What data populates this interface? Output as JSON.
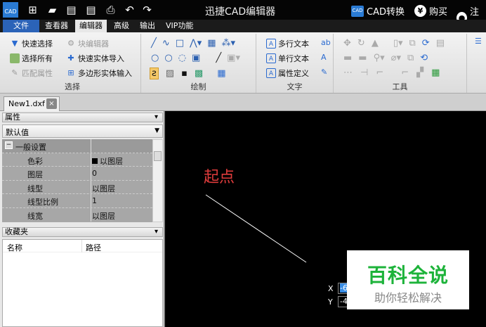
{
  "titlebar": {
    "title": "迅捷CAD编辑器",
    "logo": "CAD",
    "convert": "CAD转换",
    "buy": "购买",
    "register": "注册",
    "icons": [
      "new-icon",
      "open-icon",
      "save-icon",
      "save-as-icon",
      "print-icon",
      "undo-icon",
      "redo-icon"
    ]
  },
  "menu": {
    "tabs": [
      "文件",
      "查看器",
      "编辑器",
      "高级",
      "输出",
      "VIP功能"
    ],
    "active": "编辑器"
  },
  "ribbon": {
    "select": {
      "label": "选择",
      "items": [
        "快速选择",
        "选择所有",
        "匹配属性",
        "块编辑器",
        "快速实体导入",
        "多边形实体输入"
      ]
    },
    "draw": {
      "label": "绘制"
    },
    "text": {
      "label": "文字",
      "items": [
        "多行文本",
        "单行文本",
        "属性定义"
      ]
    },
    "tools": {
      "label": "工具"
    }
  },
  "doc_tab": {
    "name": "New1.dxf",
    "close": "×"
  },
  "properties": {
    "title": "属性",
    "pin": "ᵖ",
    "selector": "默认值",
    "group": "一般设置",
    "rows": [
      {
        "k": "色彩",
        "v": "以图层"
      },
      {
        "k": "图层",
        "v": "0"
      },
      {
        "k": "线型",
        "v": "以图层"
      },
      {
        "k": "线型比例",
        "v": "1"
      },
      {
        "k": "线宽",
        "v": "以图层"
      }
    ]
  },
  "favorites": {
    "title": "收藏夹",
    "pin": "ᵖ",
    "columns": [
      "名称",
      "路径"
    ]
  },
  "canvas": {
    "label": "起点",
    "x_label": "X",
    "y_label": "Y",
    "x_value": "-6",
    "y_value": "-4"
  },
  "watermark": {
    "title": "百科全说",
    "subtitle": "助你轻松解决",
    "color": "#1db33a"
  }
}
